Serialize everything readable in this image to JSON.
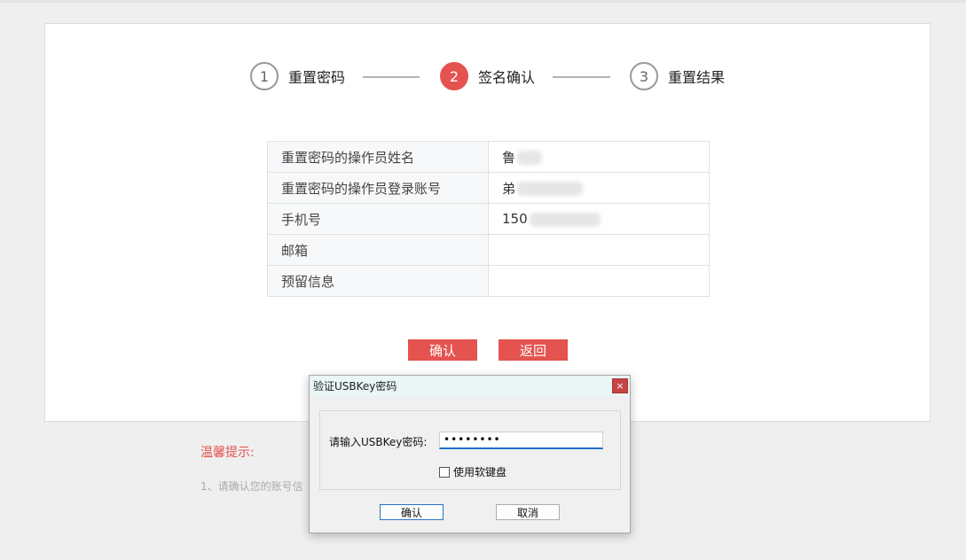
{
  "steps": [
    {
      "number": "1",
      "label": "重置密码",
      "active": false
    },
    {
      "number": "2",
      "label": "签名确认",
      "active": true
    },
    {
      "number": "3",
      "label": "重置结果",
      "active": false
    }
  ],
  "info_rows": [
    {
      "key": "重置密码的操作员姓名",
      "value": "鲁"
    },
    {
      "key": "重置密码的操作员登录账号",
      "value": "弟"
    },
    {
      "key": "手机号",
      "value": "150"
    },
    {
      "key": "邮箱",
      "value": ""
    },
    {
      "key": "预留信息",
      "value": ""
    }
  ],
  "actions": {
    "confirm_label": "确认",
    "back_label": "返回"
  },
  "tips": {
    "title": "温馨提示:",
    "line1": "1、请确认您的账号信"
  },
  "dialog": {
    "title": "验证USBKey密码",
    "close_label": "×",
    "password_label": "请输入USBKey密码:",
    "password_value": "••••••••",
    "soft_keyboard_label": "使用软键盘",
    "ok_label": "确认",
    "cancel_label": "取消"
  },
  "colors": {
    "accent": "#e4534f",
    "inactive_step": "#999999"
  }
}
